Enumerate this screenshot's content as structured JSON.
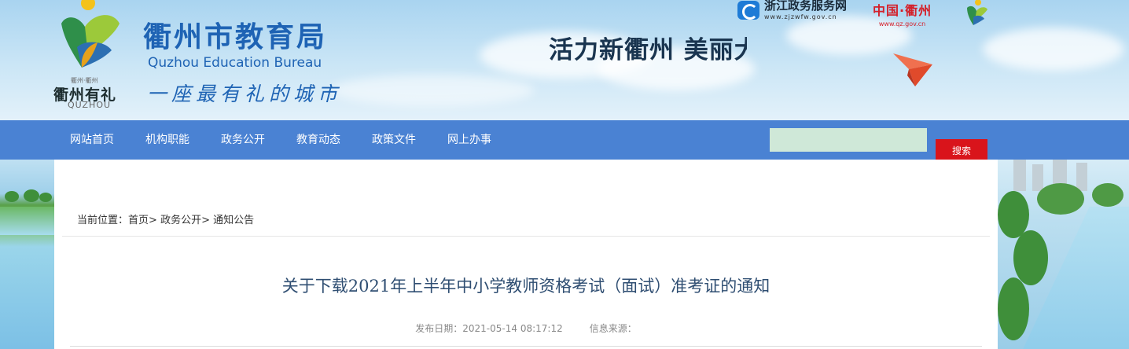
{
  "header": {
    "city_logo": {
      "small_text": "衢州·衢州",
      "name": "衢州有礼",
      "en": "QUZHOU"
    },
    "bureau": {
      "name_cn": "衢州市教育局",
      "name_en": "Quzhou Education Bureau",
      "slogan": "一座最有礼的城市"
    },
    "banner_slogan": "活力新衢州  美丽大花园",
    "links": {
      "zjzwfw": {
        "name": "浙江政务服务网",
        "url_text": "www.zjzwfw.gov.cn"
      },
      "qz": {
        "name": "中国·衢州",
        "url_text": "www.qz.gov.cn"
      }
    },
    "icons": [
      "city-emblem-icon",
      "zjzwfw-logo-icon",
      "qz-emblem-icon",
      "paper-plane-icon"
    ]
  },
  "nav": {
    "items": [
      "网站首页",
      "机构职能",
      "政务公开",
      "教育动态",
      "政策文件",
      "网上办事"
    ],
    "search": {
      "value": "",
      "placeholder": "",
      "button_label": "搜索"
    }
  },
  "breadcrumb": {
    "prefix": "当前位置：",
    "items": [
      "首页",
      "政务公开",
      "通知公告"
    ],
    "separator": ">"
  },
  "article": {
    "title": "关于下载2021年上半年中小学教师资格考试（面试）准考证的通知",
    "publish_label": "发布日期：",
    "publish_date": "2021-05-14 08:17:12",
    "source_label": "信息来源：",
    "source_value": ""
  },
  "colors": {
    "nav_bg": "#4a82d3",
    "brand_blue": "#1e63b4",
    "search_button": "#d9141b",
    "search_input_bg": "#cfe8d8",
    "title_color": "#2f4e72",
    "qz_red": "#d4202a"
  }
}
